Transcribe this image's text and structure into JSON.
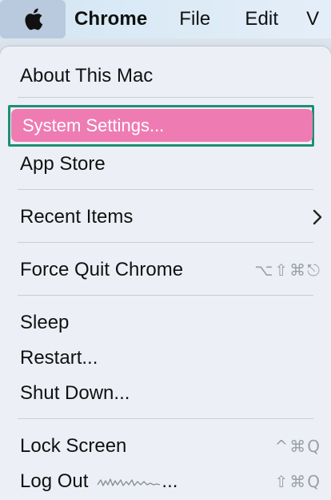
{
  "menubar": {
    "apple_icon": "apple-logo-icon",
    "app_name": "Chrome",
    "items": [
      "File",
      "Edit",
      "V"
    ]
  },
  "apple_menu": {
    "about": "About This Mac",
    "system_settings": "System Settings...",
    "app_store": "App Store",
    "recent_items": "Recent Items",
    "force_quit": "Force Quit Chrome",
    "force_quit_shortcut": "⌥⇧⌘⎋",
    "sleep": "Sleep",
    "restart": "Restart...",
    "shut_down": "Shut Down...",
    "lock_screen": "Lock Screen",
    "lock_screen_shortcut": "^⌘Q",
    "log_out": "Log Out",
    "log_out_suffix": "...",
    "log_out_shortcut": "⇧⌘Q"
  },
  "colors": {
    "highlight": "#ee7cb3",
    "focus_frame": "#1f8f74",
    "apple_button_bg": "#b9c9de"
  }
}
